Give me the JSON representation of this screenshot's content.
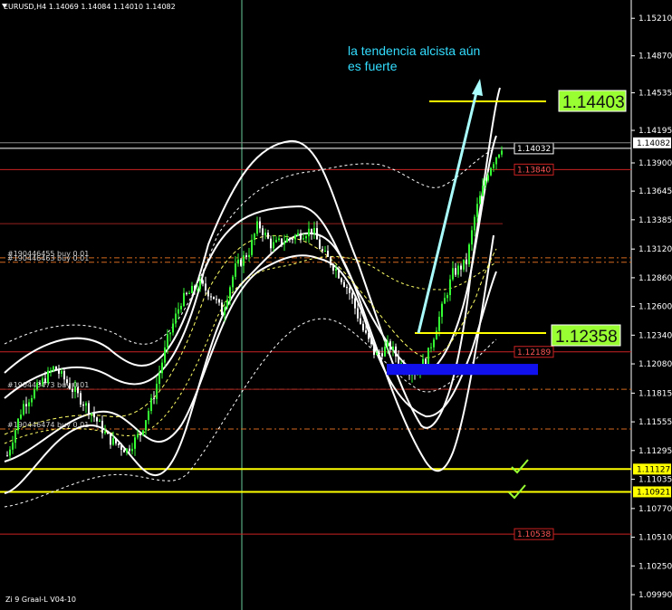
{
  "header": {
    "symbol_line": "EURUSD,H4  1.14069 1.14084 1.14010 1.14082"
  },
  "footer": {
    "indicator_name": "Zi 9 Graal-L V04-10"
  },
  "annotation": {
    "line1": "la tendencia alcista aún",
    "line2": "es fuerte"
  },
  "chart_data": {
    "type": "candlestick",
    "symbol": "EURUSD",
    "timeframe": "H4",
    "ohlc_last": {
      "open": 1.14069,
      "high": 1.14084,
      "low": 1.1401,
      "close": 1.14082
    },
    "ylim": [
      1.099,
      1.1531
    ],
    "y_ticks": [
      "1.15210",
      "1.14870",
      "1.14535",
      "1.14195",
      "1.13900",
      "1.13645",
      "1.13385",
      "1.13120",
      "1.12860",
      "1.12600",
      "1.12340",
      "1.12080",
      "1.11815",
      "1.11555",
      "1.11295",
      "1.11035",
      "1.10770",
      "1.10510",
      "1.10250",
      "1.09990"
    ],
    "current_price": "1.14082",
    "price_tags": [
      {
        "label": "1.14032",
        "value": 1.14032,
        "color": "#ffffff",
        "style": "white"
      },
      {
        "label": "1.13840",
        "value": 1.1384,
        "color": "#cc2222",
        "style": "red"
      },
      {
        "label": "1.12189",
        "value": 1.12189,
        "color": "#cc2222",
        "style": "red"
      },
      {
        "label": "1.10538",
        "value": 1.10538,
        "color": "#cc2222",
        "style": "red"
      },
      {
        "label": "1.11127",
        "value": 1.11127,
        "color": "#ffff00",
        "style": "yellow"
      },
      {
        "label": "1.10921",
        "value": 1.10921,
        "color": "#ffff00",
        "style": "yellow"
      }
    ],
    "targets": [
      {
        "label": "1.14403",
        "value": 1.14403
      },
      {
        "label": "1.12358",
        "value": 1.12358
      }
    ],
    "order_lines": [
      {
        "label": "#190446455 buy 0.01",
        "value": 1.1304
      },
      {
        "label": "#190446463 buy 0.01",
        "value": 1.13
      },
      {
        "label": "#190446473 buy 0.01",
        "value": 1.1185
      },
      {
        "label": "#190446474 buy 0.01",
        "value": 1.1149
      }
    ],
    "support_zone": [
      1.1198,
      1.1208
    ],
    "colors": {
      "bull": "#33ff33",
      "bear": "#ffffff",
      "band": "#ffffff",
      "ma": "#ffff66",
      "accent": "#aaffff",
      "target_bg": "#99ff33"
    }
  }
}
